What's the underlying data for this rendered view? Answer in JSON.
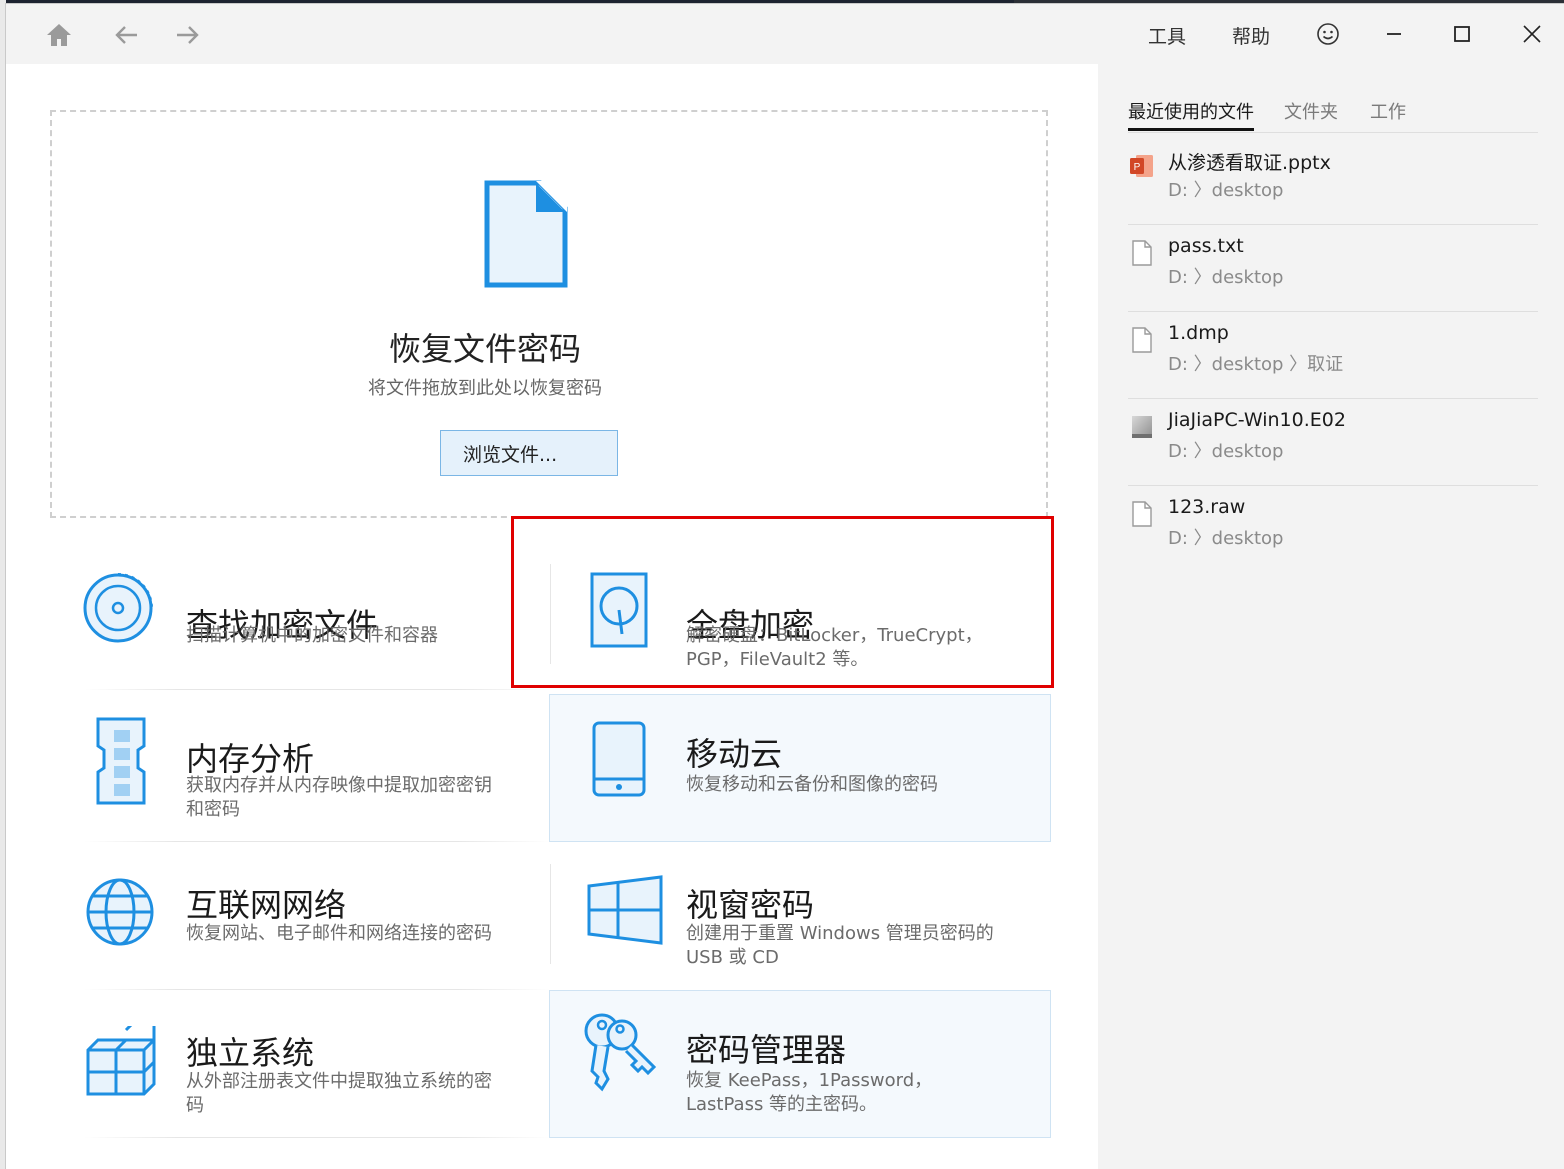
{
  "titlebar": {
    "menu_tools": "工具",
    "menu_help": "帮助",
    "icons": [
      "home-icon",
      "back-arrow-icon",
      "forward-arrow-icon",
      "smiley-icon",
      "minimize-icon",
      "maximize-icon",
      "close-icon"
    ]
  },
  "dropzone": {
    "title": "恢复文件密码",
    "subtitle": "将文件拖放到此处以恢复密码",
    "browse_label": "浏览文件..."
  },
  "tiles": {
    "find_encrypted": {
      "title": "查找加密文件",
      "desc": "扫描计算机中的加密文件和容器"
    },
    "full_disk": {
      "title": "全盘加密",
      "desc": "解密硬盘：BitLocker，TrueCrypt，PGP，FileVault2 等。"
    },
    "memory": {
      "title": "内存分析",
      "desc": "获取内存并从内存映像中提取加密密钥和密码"
    },
    "mobile_cloud": {
      "title": "移动云",
      "desc": "恢复移动和云备份和图像的密码"
    },
    "internet": {
      "title": "互联网网络",
      "desc": "恢复网站、电子邮件和网络连接的密码"
    },
    "windows": {
      "title": "视窗密码",
      "desc": "创建用于重置 Windows 管理员密码的 USB 或 CD"
    },
    "standalone": {
      "title": "独立系统",
      "desc": "从外部注册表文件中提取独立系统的密码"
    },
    "password_manager": {
      "title": "密码管理器",
      "desc": "恢复 KeePass，1Password，LastPass 等的主密码。"
    }
  },
  "right_panel": {
    "tabs": [
      "最近使用的文件",
      "文件夹",
      "工作"
    ],
    "active_tab": 0,
    "recent": [
      {
        "name": "从渗透看取证.pptx",
        "path": "D: 〉desktop",
        "icon": "pptx-icon"
      },
      {
        "name": "pass.txt",
        "path": "D: 〉desktop",
        "icon": "file-icon"
      },
      {
        "name": "1.dmp",
        "path": "D: 〉desktop 〉取证",
        "icon": "file-icon"
      },
      {
        "name": "JiaJiaPC-Win10.E02",
        "path": "D: 〉desktop",
        "icon": "disk-image-icon"
      },
      {
        "name": "123.raw",
        "path": "D: 〉desktop",
        "icon": "file-icon"
      }
    ]
  },
  "colors": {
    "accent_blue": "#1e8fe1",
    "selection_red": "#e00000",
    "panel_bg": "#f3f3f3"
  }
}
